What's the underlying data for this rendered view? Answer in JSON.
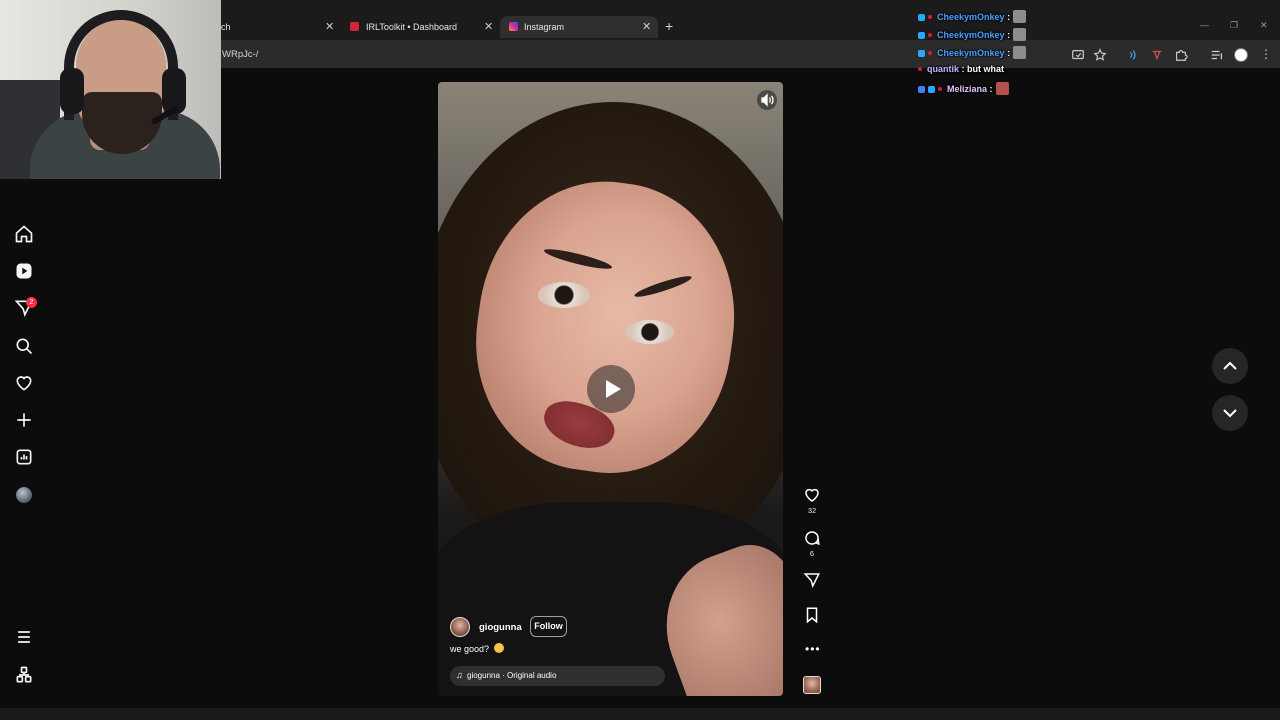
{
  "browser": {
    "tabs": [
      {
        "title": "ch",
        "active": false
      },
      {
        "title": "IRLToolkit • Dashboard",
        "active": false
      },
      {
        "title": "Instagram",
        "active": true
      }
    ],
    "new_tab_label": "+",
    "url": "WRpJc-/",
    "window_controls": [
      "minimize-icon",
      "restore-icon",
      "close-icon"
    ]
  },
  "sidebar": {
    "items": [
      "home-icon",
      "reels-icon",
      "messages-icon",
      "search-icon",
      "notifications-icon",
      "create-icon",
      "dashboard-icon",
      "profile-avatar"
    ],
    "messages_badge": "2",
    "bottom": [
      "menu-icon",
      "threads-icon"
    ]
  },
  "reel": {
    "owner": "giogunna",
    "follow_label": "Follow",
    "caption": "we good?",
    "audio": "giogunna · Original audio",
    "likes": "32",
    "comments": "6"
  },
  "chat": {
    "lines": [
      {
        "user": "CheekymOnkey",
        "sep": ":",
        "color": "#4a9fff",
        "msg": ""
      },
      {
        "user": "CheekymOnkey",
        "sep": ":",
        "color": "#4a9fff",
        "msg": ""
      },
      {
        "user": "CheekymOnkey",
        "sep": ":",
        "color": "#4a9fff",
        "msg": ""
      },
      {
        "user": "quantik",
        "sep": ":",
        "color": "#c9b3ff",
        "msg": "but what"
      },
      {
        "user": "Meliziana",
        "sep": ":",
        "color": "#e0c3ff",
        "msg": ""
      }
    ]
  },
  "colors": {
    "accent_badge": "#ff3040",
    "page_bg": "#0c0c0d",
    "chat_user_blue": "#4a9fff"
  }
}
